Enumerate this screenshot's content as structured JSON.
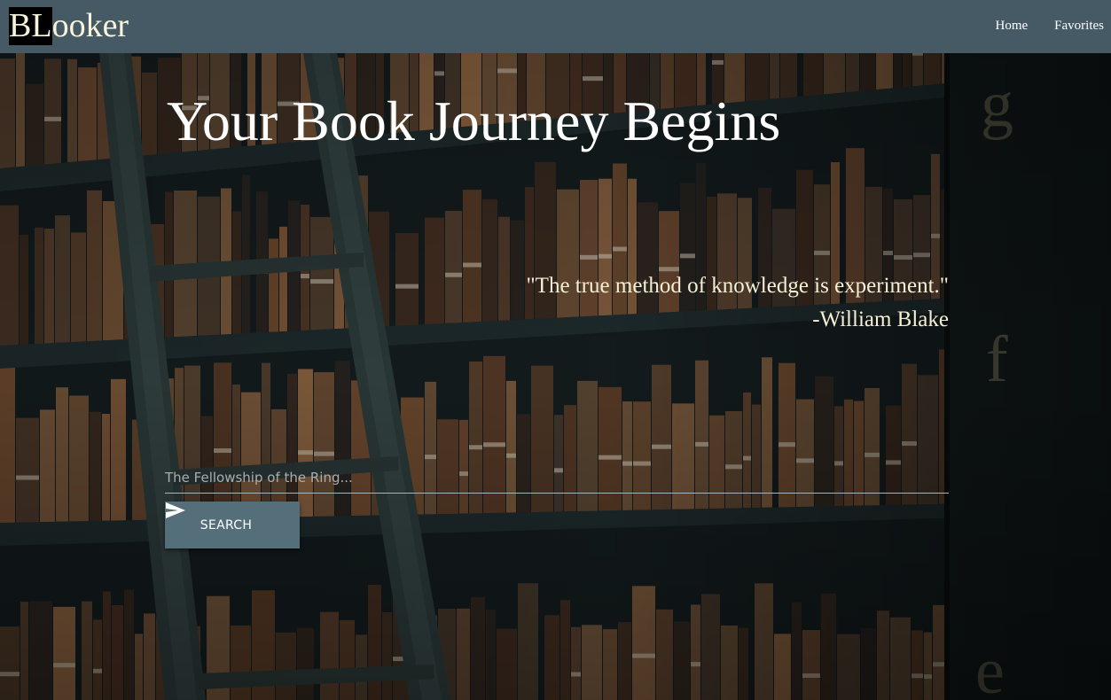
{
  "navbar": {
    "brand_highlight": "BL",
    "brand_rest": "ooker",
    "links": [
      "Home",
      "Favorites"
    ],
    "background_color": "#455a64"
  },
  "hero": {
    "title": "Your Book Journey Begins",
    "quote_text": "\"The true method of knowledge is experiment.\"",
    "quote_author": "-William Blake",
    "background_image": "library-bookshelves-with-ladder",
    "shelf_letters": [
      "g",
      "f",
      "e"
    ]
  },
  "search": {
    "placeholder": "The Fellowship of the Ring...",
    "value": "",
    "button_label": "SEARCH",
    "button_icon": "send-icon",
    "button_color": "#546e7a"
  }
}
